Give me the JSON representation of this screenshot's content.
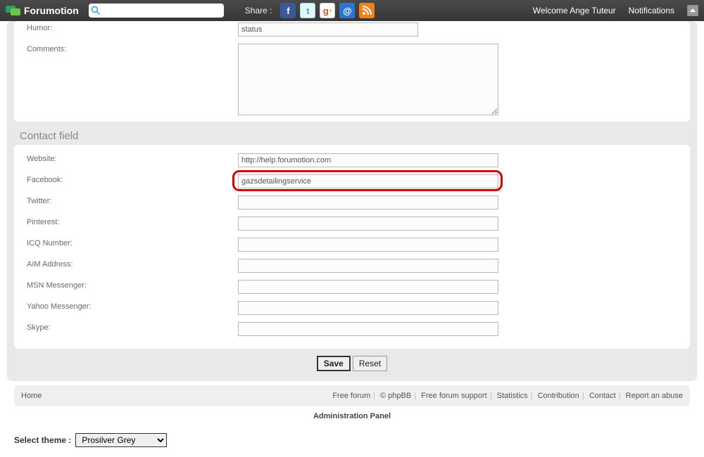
{
  "topbar": {
    "brand": "Forumotion",
    "share_label": "Share :",
    "welcome": "Welcome Ange Tuteur",
    "notifications": "Notifications"
  },
  "profile": {
    "humor_label": "Humor:",
    "humor_value": "status",
    "comments_label": "Comments:",
    "comments_value": ""
  },
  "contact": {
    "section_title": "Contact field",
    "fields": {
      "website": {
        "label": "Website:",
        "value": "http://help.forumotion.com"
      },
      "facebook": {
        "label": "Facebook:",
        "value": "gazsdetailingservice"
      },
      "twitter": {
        "label": "Twitter:",
        "value": ""
      },
      "pinterest": {
        "label": "Pinterest:",
        "value": ""
      },
      "icq": {
        "label": "ICQ Number:",
        "value": ""
      },
      "aim": {
        "label": "AIM Address:",
        "value": ""
      },
      "msn": {
        "label": "MSN Messenger:",
        "value": ""
      },
      "yahoo": {
        "label": "Yahoo Messenger:",
        "value": ""
      },
      "skype": {
        "label": "Skype:",
        "value": ""
      }
    }
  },
  "buttons": {
    "save": "Save",
    "reset": "Reset"
  },
  "footer": {
    "home": "Home",
    "links": {
      "free_forum": "Free forum",
      "phpbb": "© phpBB",
      "support": "Free forum support",
      "stats": "Statistics",
      "contribution": "Contribution",
      "contact": "Contact",
      "report": "Report an abuse"
    },
    "admin": "Administration Panel"
  },
  "theme": {
    "label": "Select theme :",
    "selected": "Prosilver Grey"
  }
}
